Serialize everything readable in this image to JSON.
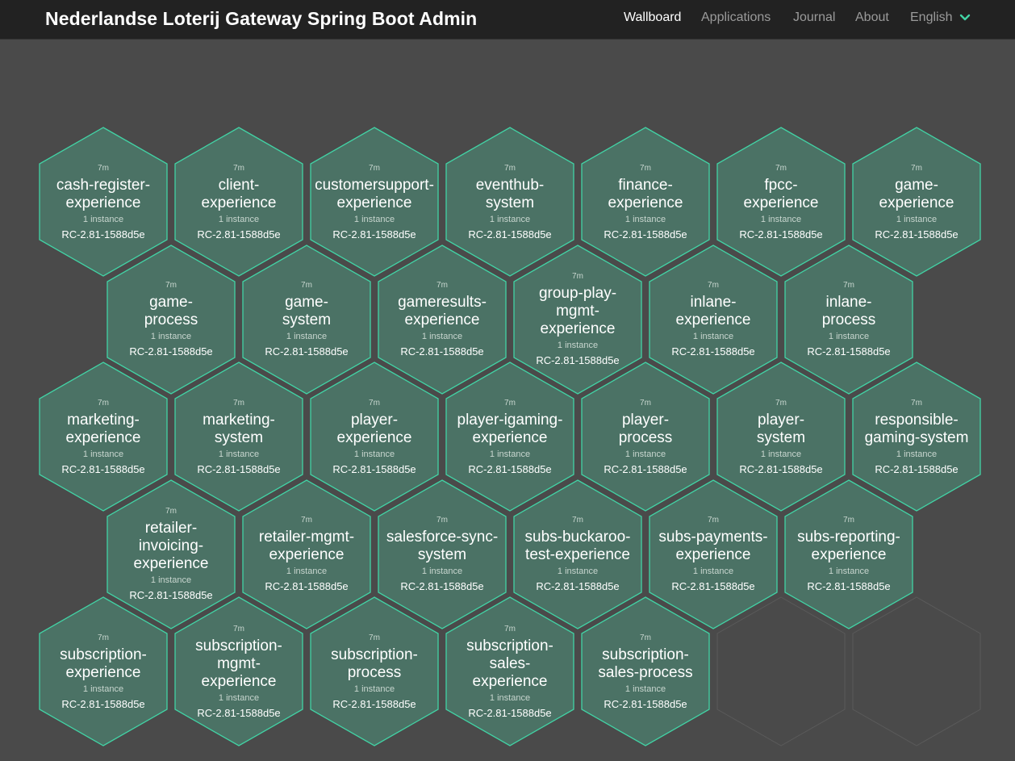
{
  "header": {
    "title": "Nederlandse Loterij Gateway Spring Boot Admin",
    "nav": [
      {
        "label": "Wallboard",
        "active": true
      },
      {
        "label": "Applications",
        "active": false
      },
      {
        "label": "Journal",
        "active": false
      },
      {
        "label": "About",
        "active": false
      }
    ],
    "language": "English"
  },
  "colors": {
    "hex_fill": "#4b7265",
    "hex_stroke": "#42d3a5",
    "empty_stroke": "#5a5a5a",
    "accent": "#42d3a5"
  },
  "applications": [
    {
      "name": "cash-register-experience",
      "lines": [
        "cash-register-",
        "experience"
      ],
      "age": "7m",
      "instances": "1 instance",
      "version": "RC-2.81-1588d5e"
    },
    {
      "name": "client-experience",
      "lines": [
        "client-",
        "experience"
      ],
      "age": "7m",
      "instances": "1 instance",
      "version": "RC-2.81-1588d5e"
    },
    {
      "name": "customersupport-experience",
      "lines": [
        "customersupport-",
        "experience"
      ],
      "age": "7m",
      "instances": "1 instance",
      "version": "RC-2.81-1588d5e"
    },
    {
      "name": "eventhub-system",
      "lines": [
        "eventhub-",
        "system"
      ],
      "age": "7m",
      "instances": "1 instance",
      "version": "RC-2.81-1588d5e"
    },
    {
      "name": "finance-experience",
      "lines": [
        "finance-",
        "experience"
      ],
      "age": "7m",
      "instances": "1 instance",
      "version": "RC-2.81-1588d5e"
    },
    {
      "name": "fpcc-experience",
      "lines": [
        "fpcc-",
        "experience"
      ],
      "age": "7m",
      "instances": "1 instance",
      "version": "RC-2.81-1588d5e"
    },
    {
      "name": "game-experience",
      "lines": [
        "game-",
        "experience"
      ],
      "age": "7m",
      "instances": "1 instance",
      "version": "RC-2.81-1588d5e"
    },
    {
      "name": "game-process",
      "lines": [
        "game-",
        "process"
      ],
      "age": "7m",
      "instances": "1 instance",
      "version": "RC-2.81-1588d5e"
    },
    {
      "name": "game-system",
      "lines": [
        "game-",
        "system"
      ],
      "age": "7m",
      "instances": "1 instance",
      "version": "RC-2.81-1588d5e"
    },
    {
      "name": "gameresults-experience",
      "lines": [
        "gameresults-",
        "experience"
      ],
      "age": "7m",
      "instances": "1 instance",
      "version": "RC-2.81-1588d5e"
    },
    {
      "name": "group-play-mgmt-experience",
      "lines": [
        "group-play-",
        "mgmt-",
        "experience"
      ],
      "age": "7m",
      "instances": "1 instance",
      "version": "RC-2.81-1588d5e"
    },
    {
      "name": "inlane-experience",
      "lines": [
        "inlane-",
        "experience"
      ],
      "age": "7m",
      "instances": "1 instance",
      "version": "RC-2.81-1588d5e"
    },
    {
      "name": "inlane-process",
      "lines": [
        "inlane-",
        "process"
      ],
      "age": "7m",
      "instances": "1 instance",
      "version": "RC-2.81-1588d5e"
    },
    {
      "name": "marketing-experience",
      "lines": [
        "marketing-",
        "experience"
      ],
      "age": "7m",
      "instances": "1 instance",
      "version": "RC-2.81-1588d5e"
    },
    {
      "name": "marketing-system",
      "lines": [
        "marketing-",
        "system"
      ],
      "age": "7m",
      "instances": "1 instance",
      "version": "RC-2.81-1588d5e"
    },
    {
      "name": "player-experience",
      "lines": [
        "player-",
        "experience"
      ],
      "age": "7m",
      "instances": "1 instance",
      "version": "RC-2.81-1588d5e"
    },
    {
      "name": "player-igaming-experience",
      "lines": [
        "player-igaming-",
        "experience"
      ],
      "age": "7m",
      "instances": "1 instance",
      "version": "RC-2.81-1588d5e"
    },
    {
      "name": "player-process",
      "lines": [
        "player-",
        "process"
      ],
      "age": "7m",
      "instances": "1 instance",
      "version": "RC-2.81-1588d5e"
    },
    {
      "name": "player-system",
      "lines": [
        "player-",
        "system"
      ],
      "age": "7m",
      "instances": "1 instance",
      "version": "RC-2.81-1588d5e"
    },
    {
      "name": "responsible-gaming-system",
      "lines": [
        "responsible-",
        "gaming-system"
      ],
      "age": "7m",
      "instances": "1 instance",
      "version": "RC-2.81-1588d5e"
    },
    {
      "name": "retailer-invoicing-experience",
      "lines": [
        "retailer-",
        "invoicing-",
        "experience"
      ],
      "age": "7m",
      "instances": "1 instance",
      "version": "RC-2.81-1588d5e"
    },
    {
      "name": "retailer-mgmt-experience",
      "lines": [
        "retailer-mgmt-",
        "experience"
      ],
      "age": "7m",
      "instances": "1 instance",
      "version": "RC-2.81-1588d5e"
    },
    {
      "name": "salesforce-sync-system",
      "lines": [
        "salesforce-sync-",
        "system"
      ],
      "age": "7m",
      "instances": "1 instance",
      "version": "RC-2.81-1588d5e"
    },
    {
      "name": "subs-buckaroo-test-experience",
      "lines": [
        "subs-buckaroo-",
        "test-experience"
      ],
      "age": "7m",
      "instances": "1 instance",
      "version": "RC-2.81-1588d5e"
    },
    {
      "name": "subs-payments-experience",
      "lines": [
        "subs-payments-",
        "experience"
      ],
      "age": "7m",
      "instances": "1 instance",
      "version": "RC-2.81-1588d5e"
    },
    {
      "name": "subs-reporting-experience",
      "lines": [
        "subs-reporting-",
        "experience"
      ],
      "age": "7m",
      "instances": "1 instance",
      "version": "RC-2.81-1588d5e"
    },
    {
      "name": "subscription-experience",
      "lines": [
        "subscription-",
        "experience"
      ],
      "age": "7m",
      "instances": "1 instance",
      "version": "RC-2.81-1588d5e"
    },
    {
      "name": "subscription-mgmt-experience",
      "lines": [
        "subscription-",
        "mgmt-",
        "experience"
      ],
      "age": "7m",
      "instances": "1 instance",
      "version": "RC-2.81-1588d5e"
    },
    {
      "name": "subscription-process",
      "lines": [
        "subscription-",
        "process"
      ],
      "age": "7m",
      "instances": "1 instance",
      "version": "RC-2.81-1588d5e"
    },
    {
      "name": "subscription-sales-experience",
      "lines": [
        "subscription-",
        "sales-",
        "experience"
      ],
      "age": "7m",
      "instances": "1 instance",
      "version": "RC-2.81-1588d5e"
    },
    {
      "name": "subscription-sales-process",
      "lines": [
        "subscription-",
        "sales-process"
      ],
      "age": "7m",
      "instances": "1 instance",
      "version": "RC-2.81-1588d5e"
    }
  ]
}
